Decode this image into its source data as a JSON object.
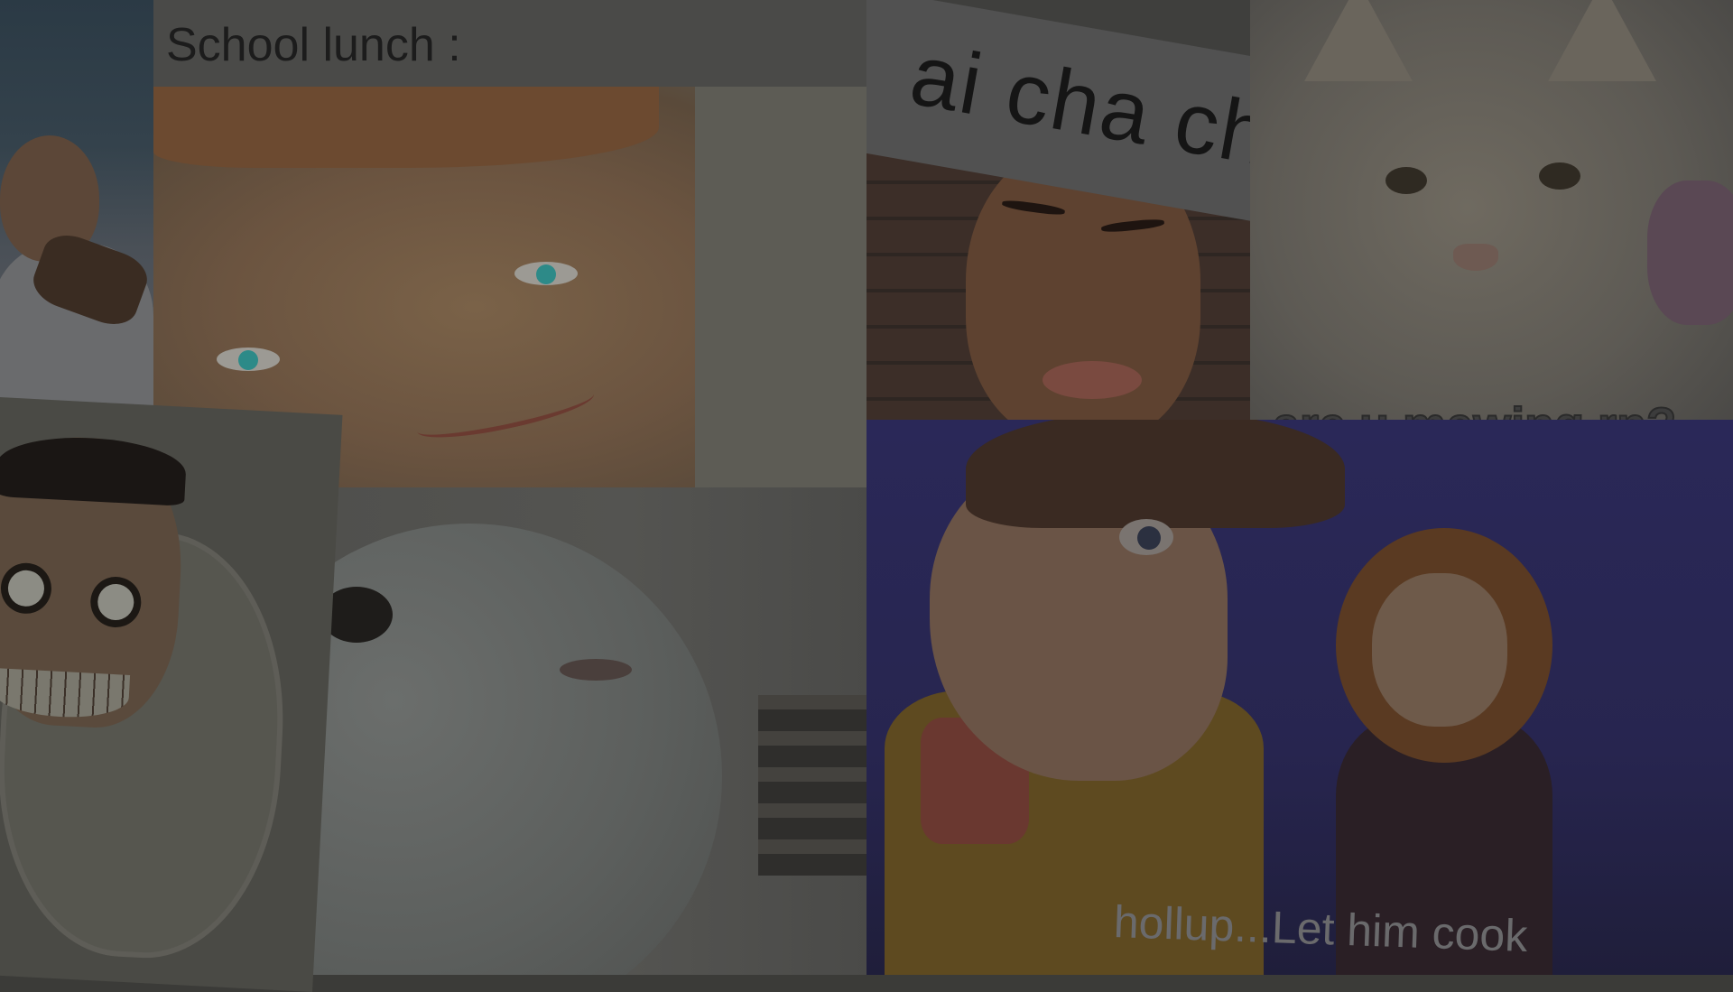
{
  "memes": {
    "school_lunch": {
      "caption": "School lunch :"
    },
    "ai_cha_cha": {
      "caption": "ai cha cha"
    },
    "cat": {
      "caption": "are u mewing rn?"
    },
    "woody": {
      "caption": "hollup...Let him cook"
    }
  }
}
